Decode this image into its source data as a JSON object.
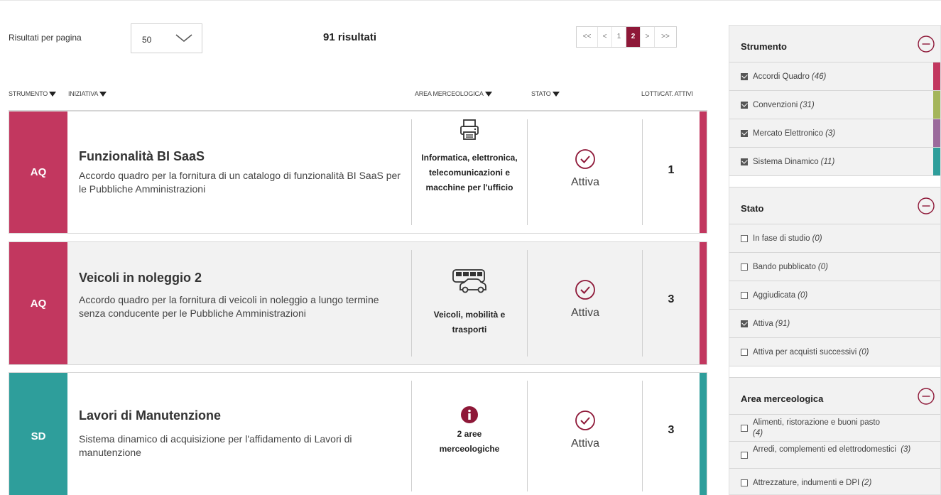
{
  "toolbar": {
    "rpp_label": "Risultati per pagina",
    "rpp_value": "50",
    "results_count": "91 risultati"
  },
  "pagination": {
    "first": "<<",
    "prev": "<",
    "pages": [
      "1",
      "2"
    ],
    "active_page": "2",
    "next": ">",
    "last": ">>"
  },
  "table": {
    "headers": {
      "strumento": "STRUMENTO",
      "iniziativa": "INIZIATIVA",
      "area": "AREA MERCEOLOGICA",
      "stato": "STATO",
      "lotti": "LOTTI/CAT. ATTIVI"
    },
    "rows": [
      {
        "tag": "AQ",
        "title": "Funzionalità BI SaaS",
        "description": "Accordo quadro per la fornitura di un catalogo di funzionalità BI SaaS per le Pubbliche Amministrazioni",
        "area_icon": "printer-icon",
        "area": "Informatica, elettronica, telecomunicazioni e macchine per l'ufficio",
        "stato": "Attiva",
        "lotti": "1",
        "color": "#c2375f"
      },
      {
        "tag": "AQ",
        "title": "Veicoli in noleggio 2",
        "description": "Accordo quadro per la fornitura di veicoli in noleggio a lungo termine senza conducente per le Pubbliche Amministrazioni",
        "area_icon": "bus-car-icon",
        "area": "Veicoli, mobilità e trasporti",
        "stato": "Attiva",
        "lotti": "3",
        "color": "#c2375f"
      },
      {
        "tag": "SD",
        "title": "Lavori di Manutenzione",
        "description": "Sistema dinamico di acquisizione per l'affidamento di Lavori di manutenzione",
        "area_icon": "info-icon",
        "area": "2 aree merceologiche",
        "stato": "Attiva",
        "lotti": "3",
        "color": "#2e9e9b"
      }
    ]
  },
  "filters": {
    "strumento": {
      "label": "Strumento",
      "options": [
        {
          "label": "Accordi Quadro",
          "count": "(46)",
          "checked": true,
          "color": "#c2375f"
        },
        {
          "label": "Convenzioni",
          "count": "(31)",
          "checked": true,
          "color": "#a4b55a"
        },
        {
          "label": "Mercato Elettronico",
          "count": "(3)",
          "checked": true,
          "color": "#9b6a9c"
        },
        {
          "label": "Sistema Dinamico",
          "count": "(11)",
          "checked": true,
          "color": "#2e9e9b"
        }
      ]
    },
    "stato": {
      "label": "Stato",
      "options": [
        {
          "label": "In fase di studio",
          "count": "(0)",
          "checked": false
        },
        {
          "label": "Bando pubblicato",
          "count": "(0)",
          "checked": false
        },
        {
          "label": "Aggiudicata",
          "count": "(0)",
          "checked": false
        },
        {
          "label": "Attiva",
          "count": "(91)",
          "checked": true
        },
        {
          "label": "Attiva per acquisti successivi",
          "count": "(0)",
          "checked": false
        }
      ]
    },
    "area": {
      "label": "Area merceologica",
      "options": [
        {
          "label": "Alimenti, ristorazione e buoni pasto",
          "count": "(4)",
          "checked": false
        },
        {
          "label": "Arredi, complementi ed elettrodomestici",
          "count": "(3)",
          "checked": false
        },
        {
          "label": "Attrezzature, indumenti e DPI",
          "count": "(2)",
          "checked": false
        }
      ]
    }
  }
}
